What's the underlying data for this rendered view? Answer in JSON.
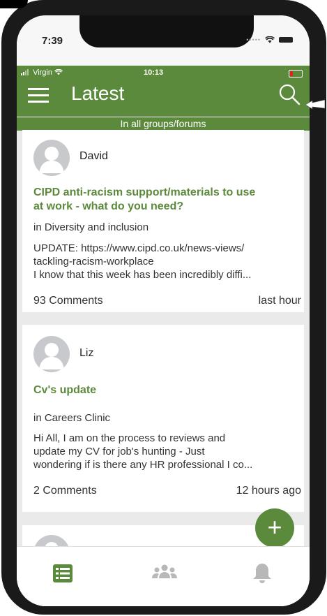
{
  "ios_status": {
    "time": "7:39"
  },
  "app_status": {
    "carrier": "Virgin",
    "time": "10:13"
  },
  "header": {
    "title": "Latest",
    "subtitle": "In all groups/forums"
  },
  "posts": [
    {
      "author": "David",
      "title_lines": [
        "CIPD anti-racism support/materials to use",
        "at work - what do you need?"
      ],
      "group": "in Diversity and inclusion",
      "excerpt_lines": [
        "UPDATE: https://www.cipd.co.uk/news-views/",
        "tackling-racism-workplace",
        "I know that this week has been incredibly diffi..."
      ],
      "comments": "93 Comments",
      "time": "last hour"
    },
    {
      "author": "Liz",
      "title_lines": [
        "Cv's update"
      ],
      "group": "in Careers Clinic",
      "excerpt_lines": [
        "Hi All, I am on the process to reviews and",
        "update my CV for job's hunting - Just",
        "wondering if is there any HR professional I co..."
      ],
      "comments": "2 Comments",
      "time": "12 hours ago"
    }
  ],
  "fab": {
    "label": "+"
  },
  "tabs": [
    {
      "icon": "feed-list-icon",
      "active": true
    },
    {
      "icon": "groups-icon",
      "active": false
    },
    {
      "icon": "bell-icon",
      "active": false
    }
  ],
  "colors": {
    "brand_green": "#5c8a3c",
    "background": "#eaeaea",
    "tab_inactive": "#b8b8b8"
  }
}
